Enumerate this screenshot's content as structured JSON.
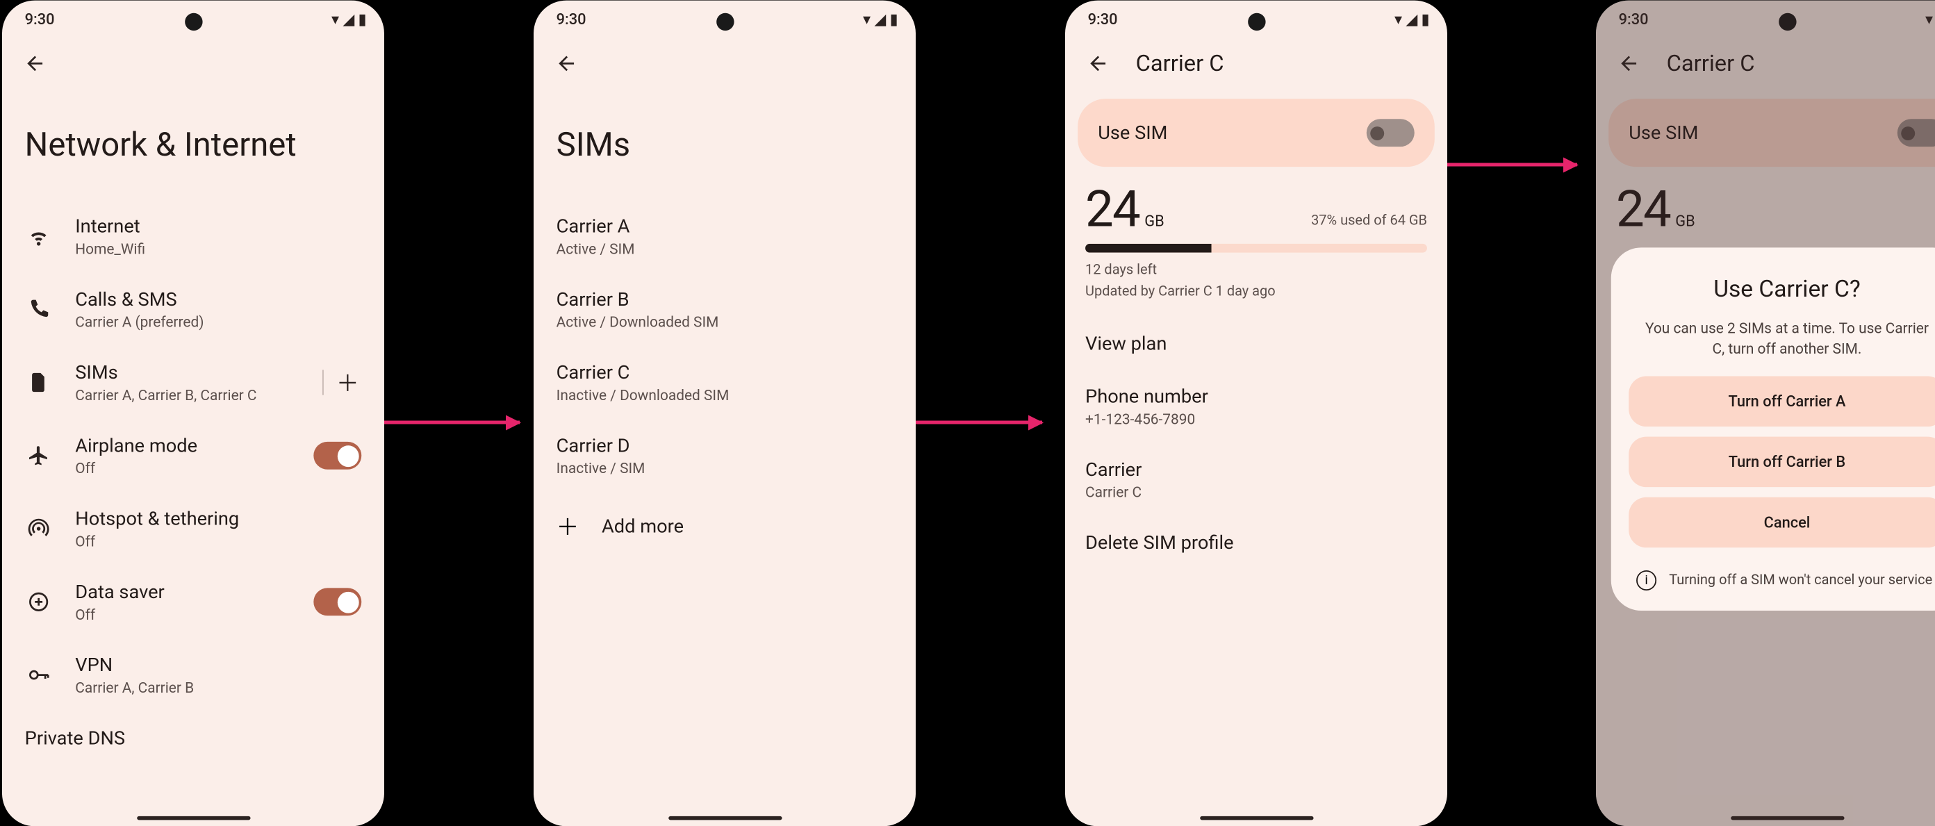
{
  "status": {
    "time": "9:30"
  },
  "screen1": {
    "title": "Network & Internet",
    "items": [
      {
        "title": "Internet",
        "sub": "Home_Wifi",
        "icon": "wifi"
      },
      {
        "title": "Calls & SMS",
        "sub": "Carrier A (preferred)",
        "icon": "phone"
      },
      {
        "title": "SIMs",
        "sub": "Carrier A, Carrier B, Carrier C",
        "icon": "sim",
        "add": true
      },
      {
        "title": "Airplane mode",
        "sub": "Off",
        "icon": "plane",
        "toggle": true
      },
      {
        "title": "Hotspot & tethering",
        "sub": "Off",
        "icon": "hotspot"
      },
      {
        "title": "Data saver",
        "sub": "Off",
        "icon": "datasaver",
        "toggle": true
      },
      {
        "title": "VPN",
        "sub": "Carrier A, Carrier B",
        "icon": "vpn"
      }
    ],
    "last": "Private DNS"
  },
  "screen2": {
    "title": "SIMs",
    "sims": [
      {
        "name": "Carrier A",
        "status": "Active / SIM"
      },
      {
        "name": "Carrier B",
        "status": "Active / Downloaded SIM"
      },
      {
        "name": "Carrier C",
        "status": "Inactive / Downloaded SIM"
      },
      {
        "name": "Carrier D",
        "status": "Inactive / SIM"
      }
    ],
    "add": "Add more"
  },
  "screen3": {
    "title": "Carrier C",
    "use_sim": "Use SIM",
    "data": {
      "amount": "24",
      "unit": "GB",
      "pct": "37% used of 64 GB",
      "days": "12 days left",
      "updated": "Updated by Carrier C 1 day ago"
    },
    "items": {
      "view_plan": "View plan",
      "phone_label": "Phone number",
      "phone_value": "+1-123-456-7890",
      "carrier_label": "Carrier",
      "carrier_value": "Carrier C",
      "delete": "Delete SIM profile"
    }
  },
  "screen4": {
    "title": "Carrier C",
    "use_sim": "Use SIM",
    "dialog": {
      "title": "Use Carrier C?",
      "desc": "You can use 2 SIMs at a time. To use Carrier C, turn off another SIM.",
      "btn_a": "Turn off Carrier A",
      "btn_b": "Turn off Carrier B",
      "cancel": "Cancel",
      "note": "Turning off a SIM won't cancel your service"
    }
  }
}
